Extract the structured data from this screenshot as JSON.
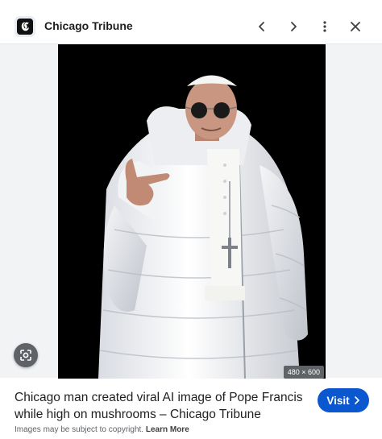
{
  "header": {
    "site_name": "Chicago Tribune",
    "logo_glyph": "𝕮",
    "icons": [
      "previous-icon",
      "next-icon",
      "more-vert-icon",
      "close-icon"
    ]
  },
  "image": {
    "dimensions": "480 × 600",
    "lens_icon": "lens-icon"
  },
  "footer": {
    "title": "Chicago man created viral AI image of Pope Francis while high on mushrooms – Chicago Tribune",
    "visit_label": "Visit",
    "copyright_text": "Images may be subject to copyright.",
    "learn_more": "Learn More"
  },
  "colors": {
    "accent": "#0b57d0",
    "text": "#1f1f1f",
    "muted": "#5f6368",
    "stage_bg": "#f1f3f4"
  }
}
